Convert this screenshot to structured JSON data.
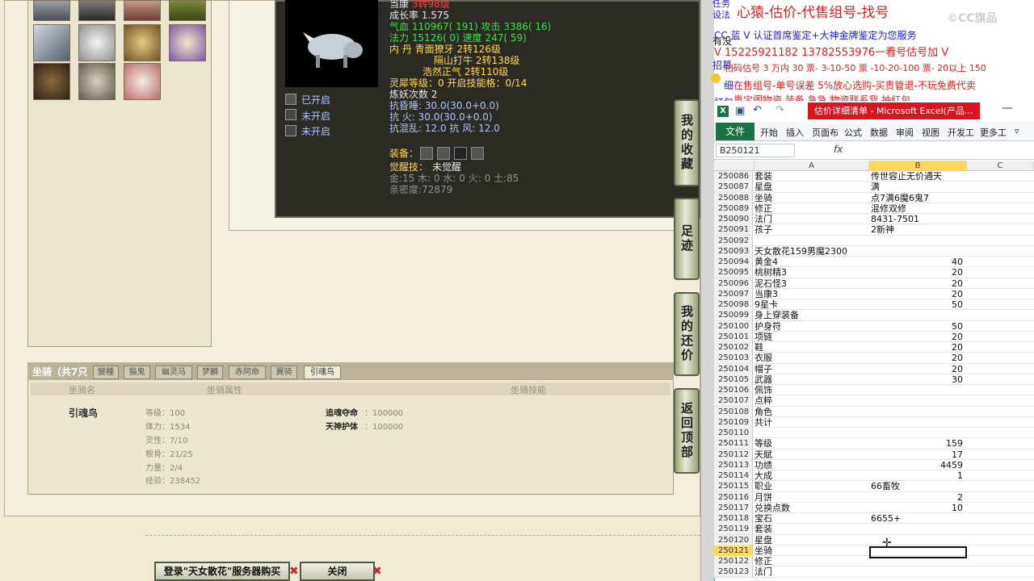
{
  "pet_tooltip": {
    "line1": "当康 3转98级",
    "growth": "成长率 1.575",
    "hp_attack": "气血 110967( 191) 攻击 3386( 16)",
    "mp_speed": "法力 15126( 0) 速度 247( 59)",
    "neidan_1": "内    丹 青面獠牙 2转126级",
    "neidan_2": "隔山打牛 2转138级",
    "neidan_3": "浩然正气 2转110级",
    "lingxi": "灵犀等级：0 开启技能格：0/14",
    "refine": "炼妖次数 2",
    "resist_sleep": "抗昏睡: 30.0(30.0+0.0)",
    "resist_fire": "抗    火: 30.0(30.0+0.0)",
    "resist_chaos": "抗混乱: 12.0 抗    风: 12.0",
    "opened": "已开启",
    "not_opened_1": "未开启",
    "not_opened_2": "未开启",
    "equip": "装备：",
    "awaken": "觉醒技：",
    "awaken_val": "未觉醒",
    "elements": "金:15 木: 0 水: 0 火: 0 土:85",
    "intimacy": "亲密度:72879"
  },
  "side_buttons": {
    "collect": "我的收藏",
    "footprint": "足迹",
    "counter": "我的还价",
    "top": "返回顶部"
  },
  "mount": {
    "tab_title": "坐骑（共7只",
    "tabs": [
      "變種",
      "猫鬼",
      "幽灵马",
      "梦麟",
      "赤阿命",
      "翼骑",
      "引魂鸟"
    ],
    "col_name": "坐骑名",
    "col_attr": "坐骑属性",
    "col_skill": "坐骑技能",
    "name": "引魂鸟",
    "level": "等级：100",
    "stamina": "体力：1534",
    "spirit": "灵性：7/10",
    "root": "根骨：21/25",
    "power": "力量：2/4",
    "exp": "经验：238452",
    "skill1_name": "追魂夺命",
    "skill1_val": "：100000",
    "skill2_name": "天神护体",
    "skill2_val": "：100000"
  },
  "bottom_buttons": {
    "login": "登录\"天女散花\"服务器购买",
    "close": "关闭"
  },
  "promo": {
    "side1": "任务",
    "side2": "设法",
    "side3": "有没",
    "side4": "招募",
    "side5": "细",
    "side6": "红包",
    "line1": "心猿-估价-代售组号-找号",
    "line2": "CC 蓝 V 认证首席鉴定+大神金牌鉴定为您服务",
    "line3": "V 15225921182      13782553976一看号估号加 V",
    "line4": "扫码估号 3 万内 30 票- 3-10-50 票  -10-20-100 票- 20以上 150",
    "line5": "在售组号-单号误差 5%放心选购-买贵管退-不玩免费代卖",
    "line6": "贵宝阁物资 装备 急急 物资联系我 抽红包",
    "watermark": "©CC旗品"
  },
  "excel": {
    "title": "估价详细清单 - Microsoft Excel(产品...",
    "file": "文件",
    "tabs": [
      "开始",
      "插入",
      "页面布",
      "公式",
      "数据",
      "审阅",
      "视图",
      "开发工",
      "更多工"
    ],
    "namebox": "B250121",
    "fx": "fx",
    "col_a": "A",
    "col_b": "B",
    "col_c": "C",
    "rows": [
      {
        "n": "250086",
        "a": "套装",
        "b": "传世容止无价通天",
        "num": false
      },
      {
        "n": "250087",
        "a": "星盘",
        "b": "满",
        "num": false
      },
      {
        "n": "250088",
        "a": "坐骑",
        "b": "点7满6魔6鬼7",
        "num": false
      },
      {
        "n": "250089",
        "a": "修正",
        "b": "混修双修",
        "num": false
      },
      {
        "n": "250090",
        "a": "法门",
        "b": "8431-7501",
        "num": false
      },
      {
        "n": "250091",
        "a": "孩子",
        "b": "2新神",
        "num": false
      },
      {
        "n": "250092",
        "a": "",
        "b": "",
        "num": false
      },
      {
        "n": "250093",
        "a": "天女散花159男魔2300",
        "b": "",
        "num": false
      },
      {
        "n": "250094",
        "a": "黄金4",
        "b": "40",
        "num": true
      },
      {
        "n": "250095",
        "a": "桃树精3",
        "b": "20",
        "num": true
      },
      {
        "n": "250096",
        "a": "泥石怪3",
        "b": "20",
        "num": true
      },
      {
        "n": "250097",
        "a": "当康3",
        "b": "20",
        "num": true
      },
      {
        "n": "250098",
        "a": "9星卡",
        "b": "50",
        "num": true
      },
      {
        "n": "250099",
        "a": "身上穿装备",
        "b": "",
        "num": false
      },
      {
        "n": "250100",
        "a": "护身符",
        "b": "50",
        "num": true
      },
      {
        "n": "250101",
        "a": "项链",
        "b": "20",
        "num": true
      },
      {
        "n": "250102",
        "a": "鞋",
        "b": "20",
        "num": true
      },
      {
        "n": "250103",
        "a": "衣服",
        "b": "20",
        "num": true
      },
      {
        "n": "250104",
        "a": "帽子",
        "b": "20",
        "num": true
      },
      {
        "n": "250105",
        "a": "武器",
        "b": "30",
        "num": true
      },
      {
        "n": "250106",
        "a": "佩饰",
        "b": "",
        "num": false
      },
      {
        "n": "250107",
        "a": "点粹",
        "b": "",
        "num": false
      },
      {
        "n": "250108",
        "a": "角色",
        "b": "",
        "num": false
      },
      {
        "n": "250109",
        "a": "共计",
        "b": "",
        "num": false
      },
      {
        "n": "250110",
        "a": "",
        "b": "",
        "num": false
      },
      {
        "n": "250111",
        "a": "等级",
        "b": "159",
        "num": true
      },
      {
        "n": "250112",
        "a": "天賦",
        "b": "17",
        "num": true
      },
      {
        "n": "250113",
        "a": "功绩",
        "b": "4459",
        "num": true
      },
      {
        "n": "250114",
        "a": "大成",
        "b": "1",
        "num": true
      },
      {
        "n": "250115",
        "a": "职业",
        "b": "66畜牧",
        "num": false
      },
      {
        "n": "250116",
        "a": "月饼",
        "b": "2",
        "num": true
      },
      {
        "n": "250117",
        "a": "兑换点数",
        "b": "10",
        "num": true
      },
      {
        "n": "250118",
        "a": "宝石",
        "b": "6655+",
        "num": false
      },
      {
        "n": "250119",
        "a": "套装",
        "b": "",
        "num": false
      },
      {
        "n": "250120",
        "a": "星盘",
        "b": "",
        "num": false
      },
      {
        "n": "250121",
        "a": "坐骑",
        "b": "",
        "num": false
      },
      {
        "n": "250122",
        "a": "修正",
        "b": "",
        "num": false
      },
      {
        "n": "250123",
        "a": "法门",
        "b": "",
        "num": false
      }
    ]
  }
}
